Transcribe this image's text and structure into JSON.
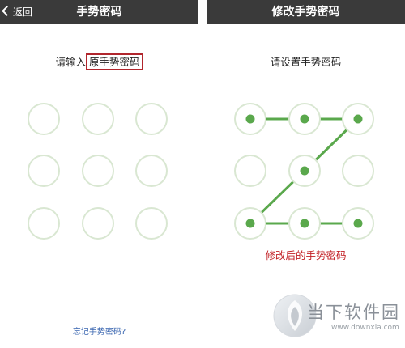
{
  "left_screen": {
    "back_label": "返回",
    "title": "手势密码",
    "prompt_prefix": "请输入",
    "prompt_highlight": "原手势密码",
    "forgot_link": "忘记手势密码?"
  },
  "right_screen": {
    "title": "修改手势密码",
    "prompt": "请设置手势密码",
    "result_note": "修改后的手势密码",
    "selected_pattern": [
      1,
      2,
      3,
      5,
      7,
      8,
      9
    ]
  },
  "watermark": {
    "name": "当下软件园",
    "url": "www.downxia.com"
  },
  "colors": {
    "navbar": "#3a3a3a",
    "node_ring": "#d9e7d2",
    "active_green": "#5aa84c",
    "highlight_red": "#b1262d",
    "link_blue": "#3a66b0"
  }
}
